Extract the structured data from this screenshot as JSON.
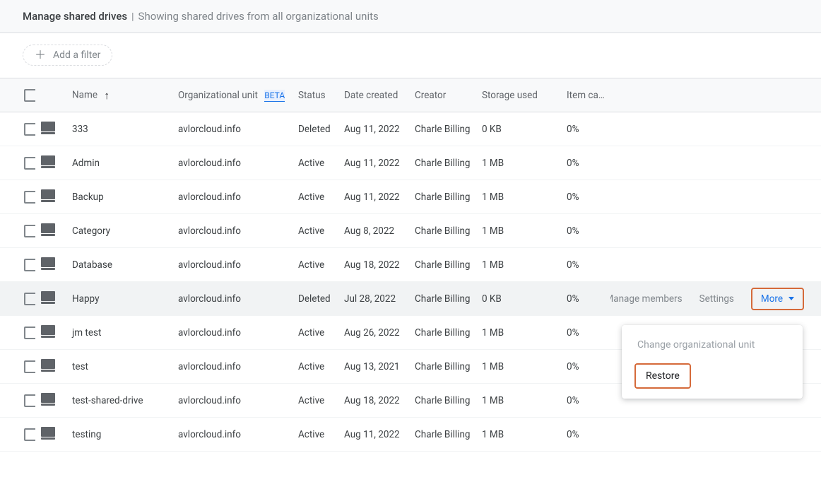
{
  "header": {
    "title": "Manage shared drives",
    "separator": "|",
    "subtitle": "Showing shared drives from all organizational units"
  },
  "filter": {
    "add_label": "Add a filter"
  },
  "columns": {
    "name": "Name",
    "org_unit": "Organizational unit",
    "beta": "BETA",
    "status": "Status",
    "date_created": "Date created",
    "creator": "Creator",
    "storage": "Storage used",
    "item_cap": "Item cap"
  },
  "row_actions": {
    "manage_members": "Manage members",
    "settings": "Settings",
    "more": "More"
  },
  "dropdown": {
    "change_ou": "Change organizational unit",
    "restore": "Restore"
  },
  "rows": [
    {
      "name": "333",
      "org": "avlorcloud.info",
      "status": "Deleted",
      "date": "Aug 11, 2022",
      "creator": "Charle Billing",
      "storage": "0 KB",
      "cap": "0%"
    },
    {
      "name": "Admin",
      "org": "avlorcloud.info",
      "status": "Active",
      "date": "Aug 11, 2022",
      "creator": "Charle Billing",
      "storage": "1 MB",
      "cap": "0%"
    },
    {
      "name": "Backup",
      "org": "avlorcloud.info",
      "status": "Active",
      "date": "Aug 11, 2022",
      "creator": "Charle Billing",
      "storage": "1 MB",
      "cap": "0%"
    },
    {
      "name": "Category",
      "org": "avlorcloud.info",
      "status": "Active",
      "date": "Aug 8, 2022",
      "creator": "Charle Billing",
      "storage": "1 MB",
      "cap": "0%"
    },
    {
      "name": "Database",
      "org": "avlorcloud.info",
      "status": "Active",
      "date": "Aug 18, 2022",
      "creator": "Charle Billing",
      "storage": "1 MB",
      "cap": "0%"
    },
    {
      "name": "Happy",
      "org": "avlorcloud.info",
      "status": "Deleted",
      "date": "Jul 28, 2022",
      "creator": "Charle Billing",
      "storage": "0 KB",
      "cap": "0%"
    },
    {
      "name": "jm test",
      "org": "avlorcloud.info",
      "status": "Active",
      "date": "Aug 26, 2022",
      "creator": "Charle Billing",
      "storage": "1 MB",
      "cap": "0%"
    },
    {
      "name": "test",
      "org": "avlorcloud.info",
      "status": "Active",
      "date": "Aug 13, 2021",
      "creator": "Charle Billing",
      "storage": "1 MB",
      "cap": "0%"
    },
    {
      "name": "test-shared-drive",
      "org": "avlorcloud.info",
      "status": "Active",
      "date": "Aug 18, 2022",
      "creator": "Charle Billing",
      "storage": "1 MB",
      "cap": "0%"
    },
    {
      "name": "testing",
      "org": "avlorcloud.info",
      "status": "Active",
      "date": "Aug 11, 2022",
      "creator": "Charle Billing",
      "storage": "1 MB",
      "cap": "0%"
    }
  ],
  "selected_row_index": 5
}
